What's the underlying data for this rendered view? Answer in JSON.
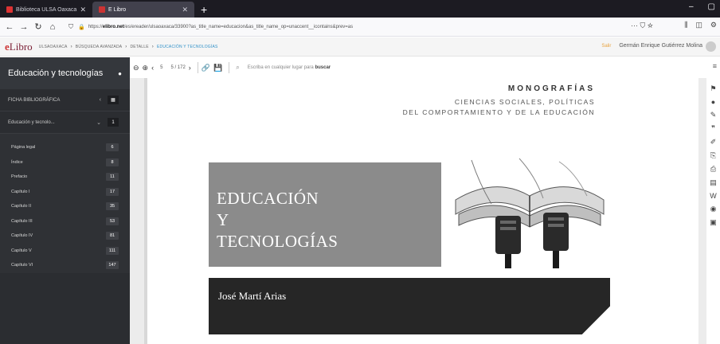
{
  "browser": {
    "tabs": [
      {
        "title": "Biblioteca ULSA Oaxaca",
        "active": false
      },
      {
        "title": "E Libro",
        "active": true
      }
    ],
    "url": {
      "prefix": "https://",
      "domain": "elibro.net",
      "path": "/es/ereader/ulsaoaxaca/33900?as_title_name=educacion&as_title_name_op=unaccent__icontains&prev=as"
    },
    "url_actions": "··· ⛉ ☆"
  },
  "app": {
    "logo_e": "e",
    "logo_rest": "Libro",
    "breadcrumbs": [
      "ULSAOAXACA",
      "BÚSQUEDA AVANZADA",
      "DETALLE",
      "EDUCACIÓN Y TECNOLOGÍAS"
    ],
    "logout": "Salir",
    "user_name": "Germán Enrique Gutiérrez Molina"
  },
  "sidebar": {
    "title": "Educación y tecnologías",
    "rows": [
      {
        "label": "FICHA BIBLIOGRÁFICA",
        "control": "‹",
        "box": "▦"
      },
      {
        "label": "Educación y tecnolo...",
        "control": "⌄",
        "box": "1"
      }
    ],
    "items": [
      {
        "label": "Página legal",
        "page": "6"
      },
      {
        "label": "Índice",
        "page": "8"
      },
      {
        "label": "Prefacio",
        "page": "11"
      },
      {
        "label": "Capítulo I",
        "page": "17"
      },
      {
        "label": "Capítulo II",
        "page": "35"
      },
      {
        "label": "Capítulo III",
        "page": "53"
      },
      {
        "label": "Capítulo IV",
        "page": "81"
      },
      {
        "label": "Capítulo V",
        "page": "111"
      },
      {
        "label": "Capítulo VI",
        "page": "147"
      }
    ]
  },
  "toolbar": {
    "current_page": "5",
    "page_count": "5 / 172",
    "search_placeholder": "Escriba en cualquier lugar para",
    "search_bold": "buscar"
  },
  "document": {
    "series": "MONOGRAFÍAS",
    "subtitle_line1": "CIENCIAS SOCIALES, POLÍTICAS",
    "subtitle_line2": "DEL COMPORTAMIENTO Y DE LA EDUCACIÓN",
    "title_lines": [
      "EDUCACIÓN",
      "Y",
      "TECNOLOGÍAS"
    ],
    "author": "José Martí Arias"
  },
  "colors": {
    "sidebar_bg": "#2b2d31",
    "accent": "#2f90c8",
    "logo": "#7a1f35",
    "logout": "#e7a23d"
  }
}
